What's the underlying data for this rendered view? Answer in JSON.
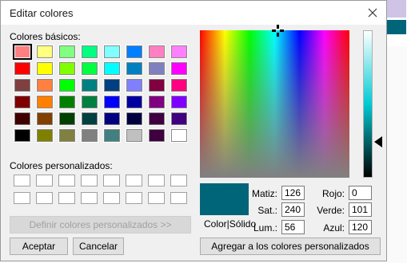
{
  "dialog": {
    "title": "Editar colores",
    "close_icon": "close-icon",
    "basic_colors_label": "Colores básicos:",
    "custom_colors_label": "Colores personalizados:",
    "basic_colors": [
      "#ff8080",
      "#ffff80",
      "#80ff80",
      "#00ff80",
      "#80ffff",
      "#0080ff",
      "#ff80c0",
      "#ff80ff",
      "#ff0000",
      "#ffff00",
      "#80ff00",
      "#00ff40",
      "#00ffff",
      "#0080c0",
      "#8080c0",
      "#ff00ff",
      "#804040",
      "#ff8040",
      "#00ff00",
      "#008080",
      "#004080",
      "#8080ff",
      "#800040",
      "#ff0080",
      "#800000",
      "#ff8000",
      "#008000",
      "#008040",
      "#0000ff",
      "#0000a0",
      "#800080",
      "#8000ff",
      "#400000",
      "#804000",
      "#004000",
      "#004040",
      "#000080",
      "#000040",
      "#400040",
      "#400080",
      "#000000",
      "#808000",
      "#808040",
      "#808080",
      "#408080",
      "#c0c0c0",
      "#400040",
      "#ffffff"
    ],
    "selected_basic_index": 0,
    "custom_colors": [
      "",
      "",
      "",
      "",
      "",
      "",
      "",
      "",
      "",
      "",
      "",
      "",
      "",
      "",
      "",
      ""
    ],
    "define_custom_button": "Definir colores personalizados >>",
    "accept_button": "Aceptar",
    "cancel_button": "Cancelar",
    "color_solid_label": "Color|Sólido",
    "preview_color": "#006579",
    "fields": {
      "hue_label": "Matiz:",
      "hue_value": "126",
      "sat_label": "Sat.:",
      "sat_value": "240",
      "lum_label": "Lum.:",
      "lum_value": "56",
      "red_label": "Rojo:",
      "red_value": "0",
      "green_label": "Verde:",
      "green_value": "101",
      "blue_label": "Azul:",
      "blue_value": "120"
    },
    "add_custom_button": "Agregar a los colores personalizados",
    "lum_arrow_icon": "triangle-left-icon",
    "crosshair_icon": "crosshair-icon"
  },
  "background_swatches": [
    "#cfc4e6",
    "#006579"
  ]
}
